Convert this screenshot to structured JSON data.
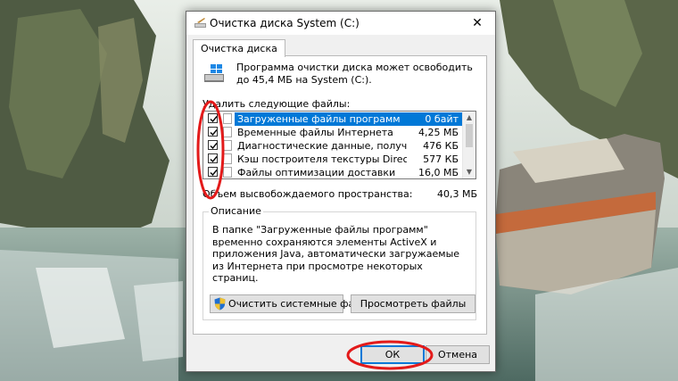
{
  "window": {
    "title": "Очистка диска  System (C:)",
    "close_glyph": "✕"
  },
  "tab": {
    "label": "Очистка диска"
  },
  "intro": {
    "text": "Программа очистки диска может освободить до 45,4 МБ на System (C:)."
  },
  "files_label": "Удалить следующие файлы:",
  "file_list": [
    {
      "name": "Загруженные файлы программ",
      "size": "0 байт",
      "checked": true,
      "selected": true
    },
    {
      "name": "Временные файлы Интернета",
      "size": "4,25 МБ",
      "checked": true,
      "selected": false
    },
    {
      "name": "Диагностические данные, полученные ...",
      "size": "476 КБ",
      "checked": true,
      "selected": false
    },
    {
      "name": "Кэш построителя текстуры DirectX",
      "size": "577 КБ",
      "checked": true,
      "selected": false
    },
    {
      "name": "Файлы оптимизации доставки",
      "size": "16,0 МБ",
      "checked": true,
      "selected": false
    }
  ],
  "space": {
    "label": "Объем высвобождаемого пространства:",
    "value": "40,3 МБ"
  },
  "description": {
    "title": "Описание",
    "text": "В папке \"Загруженные файлы программ\" временно сохраняются элементы ActiveX и приложения Java, автоматически загружаемые из Интернета при просмотре некоторых страниц."
  },
  "buttons": {
    "clean_system": "Очистить системные файлы",
    "view_files": "Просмотреть файлы",
    "ok": "ОК",
    "cancel": "Отмена"
  },
  "colors": {
    "selection": "#0078d7",
    "annotation_red": "#e31a1a",
    "dialog_bg": "#f0f0f0"
  }
}
